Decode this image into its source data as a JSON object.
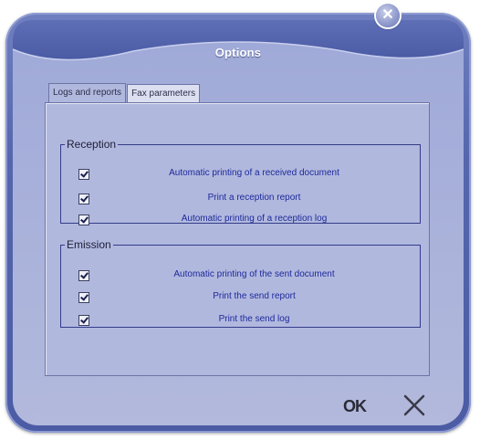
{
  "window": {
    "title": "Options",
    "close_glyph": "✕"
  },
  "tabs": [
    {
      "label": "Logs and reports",
      "active": true
    },
    {
      "label": "Fax parameters",
      "active": false
    }
  ],
  "reception": {
    "legend": "Reception",
    "items": [
      {
        "label": "Automatic printing of a received document",
        "checked": true
      },
      {
        "label": "Print a reception report",
        "checked": true
      },
      {
        "label": "Automatic printing of a reception log",
        "checked": true
      }
    ]
  },
  "emission": {
    "legend": "Emission",
    "items": [
      {
        "label": "Automatic printing of the sent document",
        "checked": true
      },
      {
        "label": "Print the send report",
        "checked": true
      },
      {
        "label": "Print the send log",
        "checked": true
      }
    ]
  },
  "footer": {
    "ok_label": "OK",
    "cancel_icon": "x-icon"
  },
  "colors": {
    "frame": "#5566ad",
    "panel": "#b1b8de",
    "label_blue": "#1d2a9a",
    "group_border": "#333c8a"
  }
}
